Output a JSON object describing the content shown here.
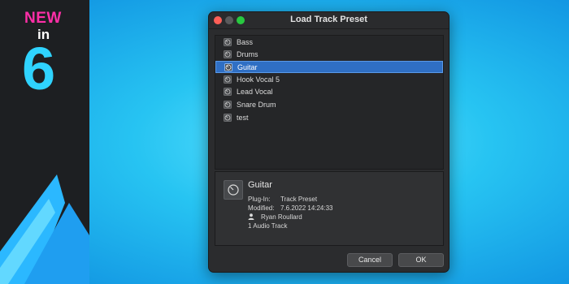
{
  "banner": {
    "new": "NEW",
    "in": "in",
    "version": "6"
  },
  "dialog": {
    "title": "Load Track Preset",
    "presets": [
      {
        "label": "Bass",
        "selected": false
      },
      {
        "label": "Drums",
        "selected": false
      },
      {
        "label": "Guitar",
        "selected": true
      },
      {
        "label": "Hook Vocal 5",
        "selected": false
      },
      {
        "label": "Lead Vocal",
        "selected": false
      },
      {
        "label": "Snare Drum",
        "selected": false
      },
      {
        "label": "test",
        "selected": false
      }
    ],
    "info": {
      "name": "Guitar",
      "plugin_key": "Plug-In:",
      "plugin_value": "Track Preset",
      "modified_key": "Modified:",
      "modified_value": "7.6.2022 14:24:33",
      "author": "Ryan Roullard",
      "tracks": "1 Audio Track"
    },
    "buttons": {
      "cancel": "Cancel",
      "ok": "OK"
    }
  },
  "colors": {
    "selection": "#2f6fc4",
    "accent_cyan": "#2fd3ff",
    "accent_pink": "#ff2fa8"
  },
  "icons": {
    "preset": "preset-knob-icon",
    "author": "person-icon"
  }
}
